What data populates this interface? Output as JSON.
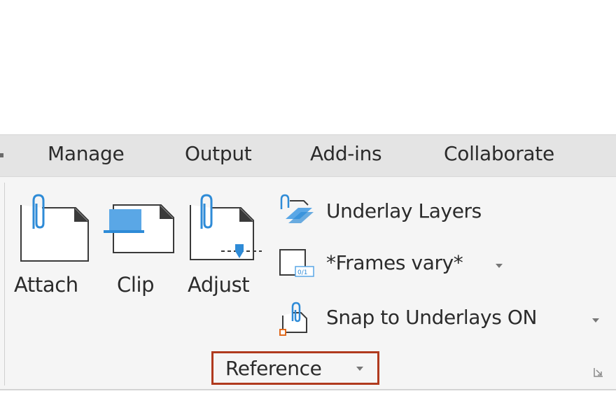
{
  "tabs": {
    "manage": "Manage",
    "output": "Output",
    "addins": "Add-ins",
    "collaborate": "Collaborate"
  },
  "panel": {
    "title": "Reference",
    "buttons": {
      "attach": "Attach",
      "clip": "Clip",
      "adjust": "Adjust"
    },
    "items": {
      "underlay_layers": "Underlay Layers",
      "frames": "*Frames vary*",
      "snap": "Snap to Underlays ON"
    }
  },
  "colors": {
    "highlight_border": "#b03a1e",
    "accent_blue": "#2e8bd7"
  },
  "icons": {
    "attach": "paperclip-page-icon",
    "clip": "clip-rectangle-icon",
    "adjust": "adjust-underlay-icon",
    "underlay_layers": "underlay-layers-icon",
    "frames": "frames-icon",
    "snap": "snap-underlays-icon",
    "launcher": "dialog-launcher-icon"
  }
}
